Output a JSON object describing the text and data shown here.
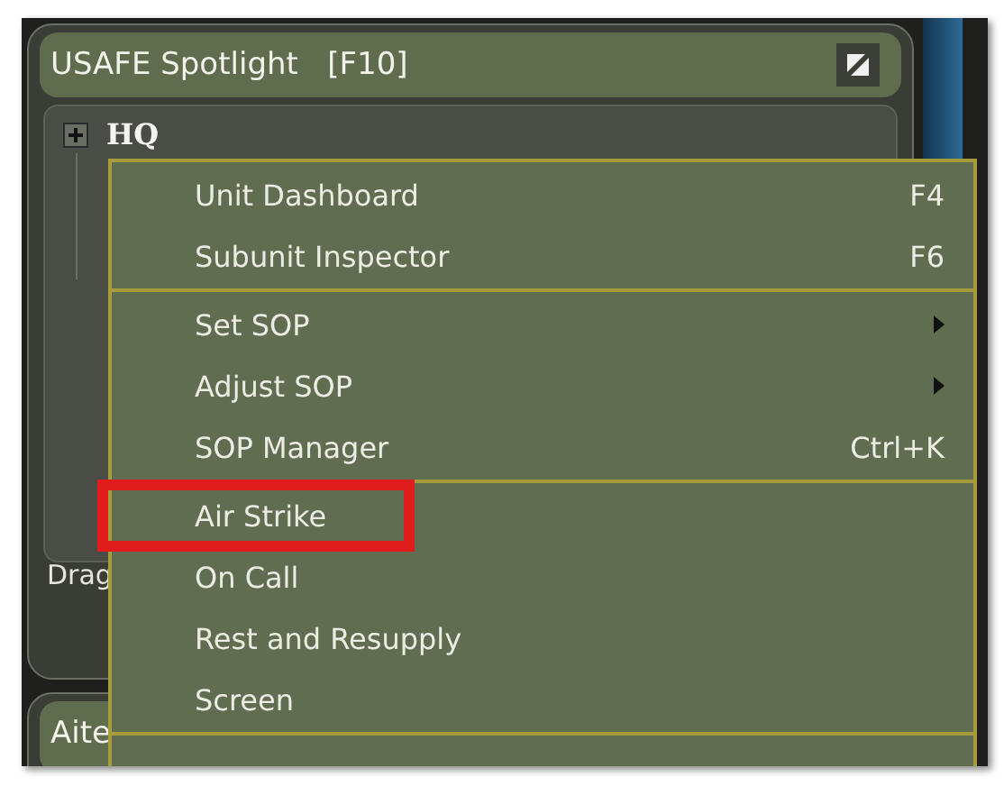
{
  "panel": {
    "title": "USAFE Spotlight   [F10]"
  },
  "tree": [
    {
      "label": "HQ",
      "expanded": false
    }
  ],
  "panel_footer": {
    "text": "Drag"
  },
  "second_panel": {
    "title": "Aite"
  },
  "context_menu": [
    {
      "kind": "item",
      "label": "Unit Dashboard",
      "shortcut": "F4",
      "submenu": false,
      "highlighted": false
    },
    {
      "kind": "item",
      "label": "Subunit Inspector",
      "shortcut": "F6",
      "submenu": false,
      "highlighted": false
    },
    {
      "kind": "separator"
    },
    {
      "kind": "item",
      "label": "Set SOP",
      "submenu": true,
      "highlighted": false
    },
    {
      "kind": "item",
      "label": "Adjust SOP",
      "submenu": true,
      "highlighted": false
    },
    {
      "kind": "item",
      "label": "SOP Manager",
      "shortcut": "Ctrl+K",
      "submenu": false,
      "highlighted": false
    },
    {
      "kind": "separator"
    },
    {
      "kind": "item",
      "label": "Air Strike",
      "submenu": false,
      "highlighted": true
    },
    {
      "kind": "item",
      "label": "On Call",
      "submenu": false,
      "highlighted": false
    },
    {
      "kind": "item",
      "label": "Rest and Resupply",
      "submenu": false,
      "highlighted": false
    },
    {
      "kind": "item",
      "label": "Screen",
      "submenu": false,
      "highlighted": false
    },
    {
      "kind": "separator"
    }
  ]
}
